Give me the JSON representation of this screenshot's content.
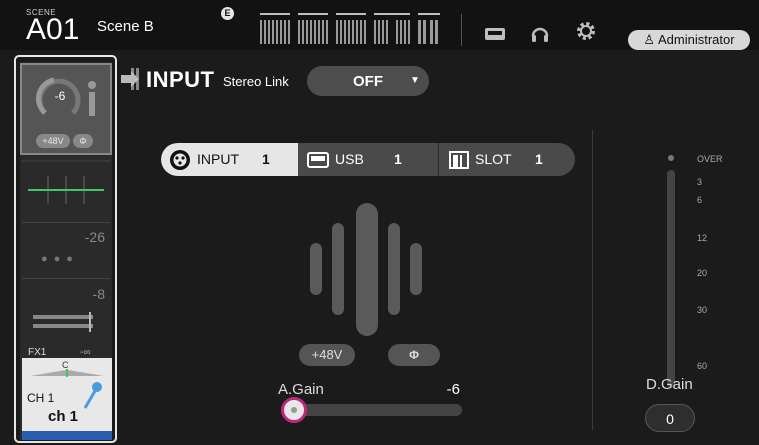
{
  "header": {
    "scene_caption": "SCENE",
    "scene_number": "A01",
    "scene_name": "Scene B",
    "edit_badge": "E",
    "user_label": "Administrator"
  },
  "strip": {
    "gain_value": "-6",
    "phantom_label": "+48V",
    "phase_label": "Φ",
    "threshold_value": "-26",
    "comp_value": "-8",
    "fx_label": "FX1",
    "fx_value": "-∞",
    "pan_label": "C",
    "channel_label": "CH 1",
    "channel_name": "ch 1"
  },
  "page": {
    "title": "INPUT",
    "stereo_link_label": "Stereo Link",
    "stereo_link_value": "OFF"
  },
  "source_tabs": [
    {
      "label": "INPUT",
      "number": "1",
      "selected": true
    },
    {
      "label": "USB",
      "number": "1",
      "selected": false
    },
    {
      "label": "SLOT",
      "number": "1",
      "selected": false
    }
  ],
  "analog": {
    "phantom_label": "+48V",
    "phase_label": "Φ",
    "gain_label": "A.Gain",
    "gain_value": "-6",
    "gain_fraction": 0.0
  },
  "meter": {
    "scale": [
      "OVER",
      "3",
      "6",
      "12",
      "20",
      "30",
      "60"
    ],
    "dgain_label": "D.Gain",
    "dgain_value": "0"
  },
  "colors": {
    "accent_magenta": "#c0267a",
    "channel_blue": "#2a5db0",
    "selected_tab": "#e6e6e6"
  }
}
